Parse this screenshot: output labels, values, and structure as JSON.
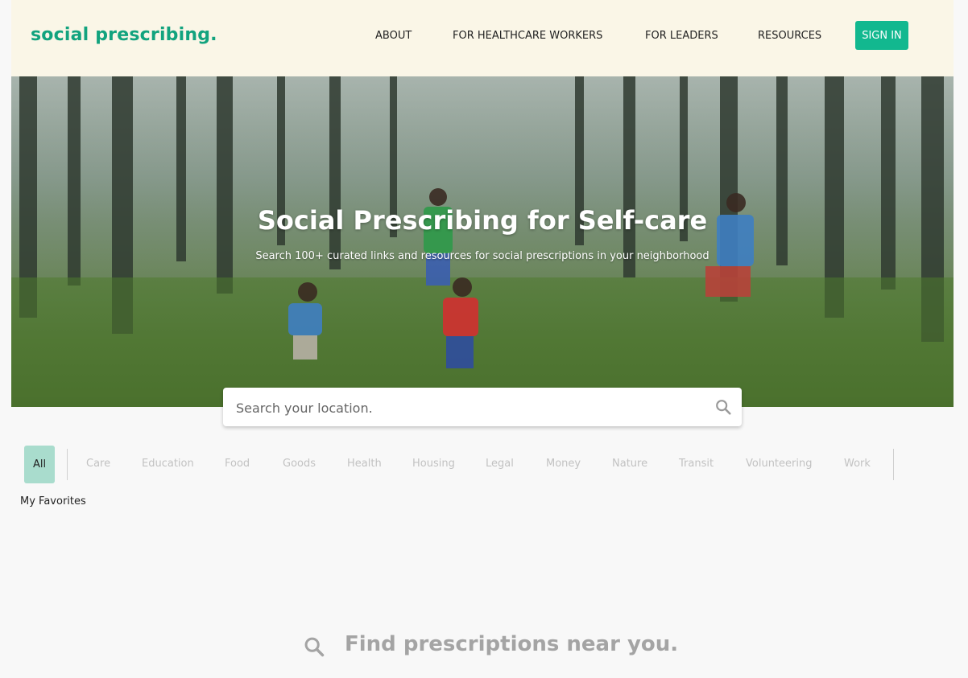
{
  "header": {
    "logo": "social prescribing.",
    "nav": [
      "ABOUT",
      "FOR HEALTHCARE WORKERS",
      "FOR LEADERS",
      "RESOURCES"
    ],
    "sign_in": "SIGN IN",
    "accent_color": "#12a37e"
  },
  "hero": {
    "title": "Social Prescribing for Self-care",
    "subtitle": "Search 100+ curated links and resources for social prescriptions in your neighborhood"
  },
  "search": {
    "placeholder": "Search your location.",
    "icon": "search-icon"
  },
  "categories": {
    "selected": "All",
    "items": [
      "Care",
      "Education",
      "Food",
      "Goods",
      "Health",
      "Housing",
      "Legal",
      "Money",
      "Nature",
      "Transit",
      "Volunteering",
      "Work"
    ]
  },
  "favorites": {
    "label": "My Favorites"
  },
  "empty_state": {
    "icon": "search-icon",
    "text": "Find prescriptions near you."
  }
}
